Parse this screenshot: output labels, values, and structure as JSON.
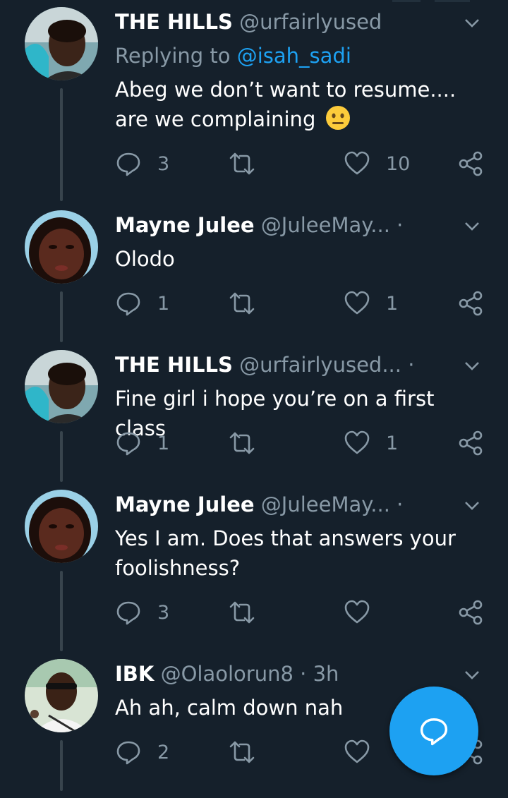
{
  "tweets": [
    {
      "name": "THE HILLS",
      "handle": "@urfairlyused",
      "time": "",
      "replying_prefix": "Replying to ",
      "replying_to": "@isah_sadi",
      "text": "Abeg we don’t want to resume.... are we complaining",
      "emoji": "neutral-face-emoji",
      "replies": "3",
      "retweets": "",
      "likes": "10"
    },
    {
      "name": "Mayne Julee",
      "handle": "@JuleeMay...",
      "time": "·",
      "text": "Olodo",
      "replies": "1",
      "retweets": "",
      "likes": "1"
    },
    {
      "name": "THE HILLS",
      "handle": "@urfairlyused...",
      "time": "·",
      "text": "Fine girl i hope you’re on a first class",
      "replies": "1",
      "retweets": "",
      "likes": "1"
    },
    {
      "name": "Mayne Julee",
      "handle": "@JuleeMay...",
      "time": "·",
      "text": "Yes I am. Does that answers your foolishness?",
      "replies": "3",
      "retweets": "",
      "likes": ""
    },
    {
      "name": "IBK",
      "handle": "@Olaolorun8",
      "time": "· 3h",
      "text": "Ah ah, calm down nah",
      "replies": "2",
      "retweets": "",
      "likes": ""
    }
  ],
  "icons": {
    "reply": "reply-icon",
    "retweet": "retweet-icon",
    "like": "heart-icon",
    "share": "share-icon",
    "caret": "chevron-down-icon",
    "compose": "compose-reply-icon"
  },
  "colors": {
    "background": "#15202b",
    "accent": "#1da1f2",
    "secondary_text": "#8899a6",
    "thread_line": "#38444d"
  }
}
